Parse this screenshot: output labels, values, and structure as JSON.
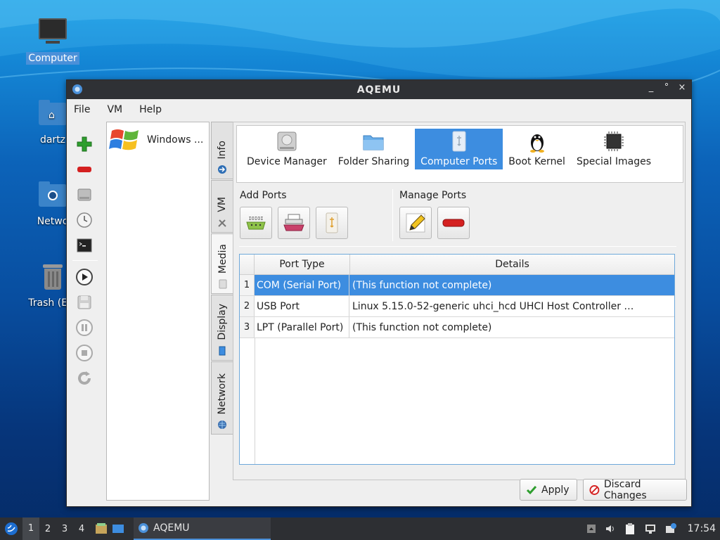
{
  "desktop": {
    "icons": [
      {
        "label": "Computer"
      },
      {
        "label": "dartz"
      },
      {
        "label": "Netwo"
      },
      {
        "label": "Trash (Em"
      }
    ]
  },
  "window": {
    "title": "AQEMU",
    "controls": [
      "_",
      "°",
      "×"
    ],
    "menu": [
      "File",
      "VM",
      "Help"
    ],
    "vm_list": [
      {
        "name": "Windows ..."
      }
    ],
    "side_tabs": [
      "Info",
      "VM",
      "Media",
      "Display",
      "Network"
    ],
    "top_buttons": [
      "Device Manager",
      "Folder Sharing",
      "Computer Ports",
      "Boot Kernel",
      "Special Images"
    ],
    "active_top_button": "Computer Ports",
    "add_ports_label": "Add Ports",
    "manage_ports_label": "Manage Ports",
    "table": {
      "headers": [
        "Port Type",
        "Details"
      ],
      "rows": [
        {
          "num": "1",
          "type": "COM (Serial Port)",
          "details": "(This function not complete)"
        },
        {
          "num": "2",
          "type": "USB Port",
          "details": "Linux 5.15.0-52-generic uhci_hcd UHCI Host Controller …"
        },
        {
          "num": "3",
          "type": "LPT (Parallel Port)",
          "details": "(This function not complete)"
        }
      ]
    },
    "apply_label": "Apply",
    "discard_label": "Discard Changes"
  },
  "taskbar": {
    "workspaces": [
      "1",
      "2",
      "3",
      "4"
    ],
    "task_label": "AQEMU",
    "clock": "17:54"
  },
  "colors": {
    "accent": "#3d8de0",
    "titlebar": "#2f3135",
    "add_green": "#2e9e2e",
    "remove_red": "#d42020"
  }
}
